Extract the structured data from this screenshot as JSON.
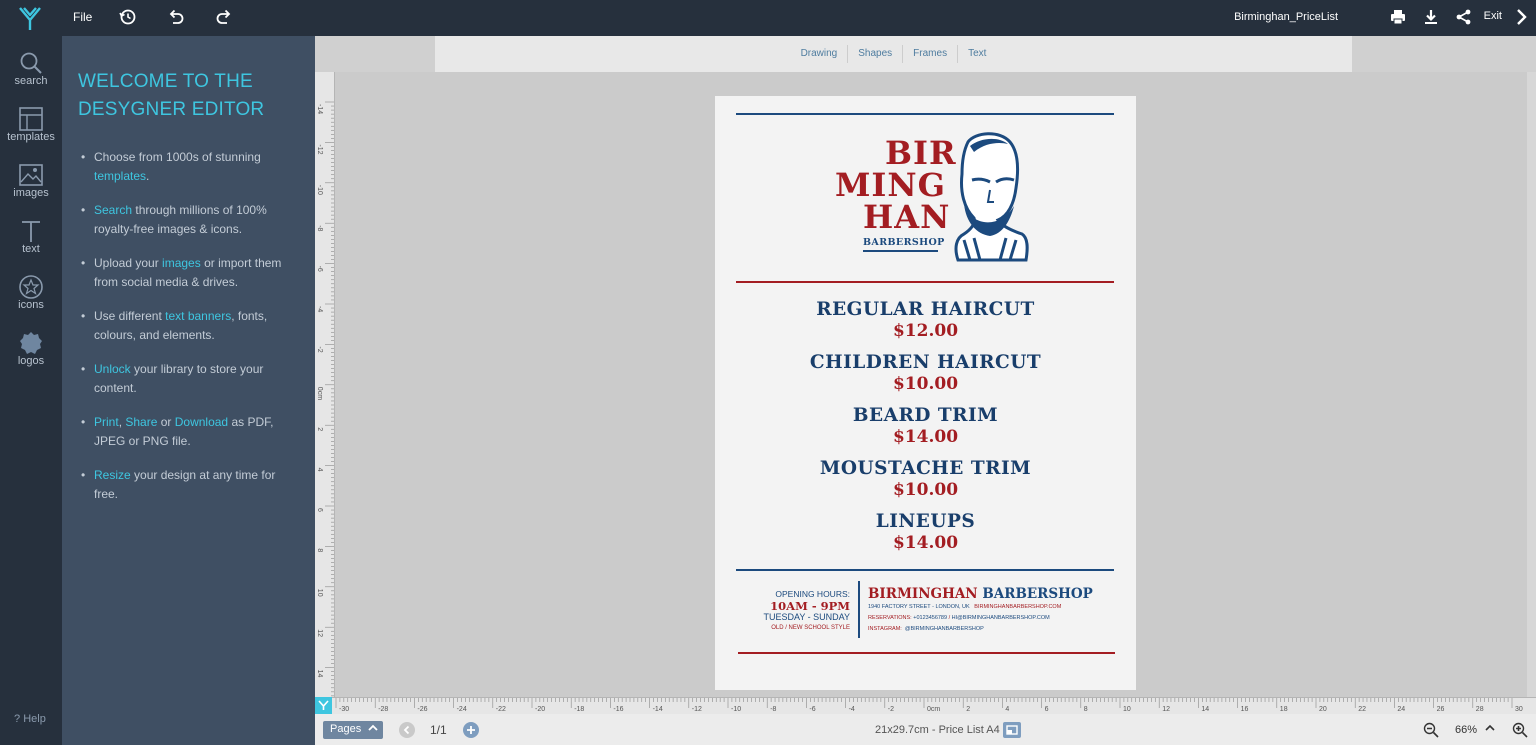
{
  "app": {
    "file_menu": "File",
    "document_name": "Birminghan_PriceList",
    "exit_label": "Exit"
  },
  "sidebar": {
    "items": [
      {
        "label": "search",
        "icon": "search-icon"
      },
      {
        "label": "templates",
        "icon": "templates-icon"
      },
      {
        "label": "images",
        "icon": "image-icon"
      },
      {
        "label": "text",
        "icon": "text-icon"
      },
      {
        "label": "icons",
        "icon": "star-icon"
      },
      {
        "label": "logos",
        "icon": "logo-shape-icon"
      }
    ],
    "help_label": "Help"
  },
  "panel": {
    "title": "WELCOME TO THE DESYGNER EDITOR",
    "bullets": [
      {
        "parts": [
          [
            "t",
            "Choose from 1000s of stunning "
          ],
          [
            "h",
            "templates"
          ],
          [
            "t",
            "."
          ]
        ]
      },
      {
        "parts": [
          [
            "h",
            "Search"
          ],
          [
            "t",
            " through millions of 100% royalty-free images & icons."
          ]
        ]
      },
      {
        "parts": [
          [
            "t",
            "Upload your "
          ],
          [
            "h",
            "images"
          ],
          [
            "t",
            " or import them from social media & drives."
          ]
        ]
      },
      {
        "parts": [
          [
            "t",
            "Use different "
          ],
          [
            "h",
            "text banners"
          ],
          [
            "t",
            ", fonts, colours, and elements."
          ]
        ]
      },
      {
        "parts": [
          [
            "h",
            "Unlock"
          ],
          [
            "t",
            " your library to store your content."
          ]
        ]
      },
      {
        "parts": [
          [
            "h",
            "Print"
          ],
          [
            "t",
            ", "
          ],
          [
            "h",
            "Share"
          ],
          [
            "t",
            " or "
          ],
          [
            "h",
            "Download"
          ],
          [
            "t",
            " as PDF, JPEG or PNG file."
          ]
        ]
      },
      {
        "parts": [
          [
            "h",
            "Resize"
          ],
          [
            "t",
            " your design at any time for free."
          ]
        ]
      }
    ]
  },
  "subtoolbar": {
    "tabs": [
      "Drawing",
      "Shapes",
      "Frames",
      "Text"
    ]
  },
  "rulers": {
    "horizontal": [
      "-30",
      "-28",
      "-26",
      "-24",
      "-22",
      "-20",
      "-18",
      "-16",
      "-14",
      "-12",
      "-10",
      "-8",
      "-6",
      "-4",
      "-2",
      "0cm",
      "2",
      "4",
      "6",
      "8",
      "10",
      "12",
      "14",
      "16",
      "18",
      "20",
      "22",
      "24",
      "26",
      "28",
      "30"
    ],
    "vertical": [
      "-14",
      "-12",
      "-10",
      "-8",
      "-6",
      "-4",
      "-2",
      "0cm",
      "2",
      "4",
      "6",
      "8",
      "10",
      "12",
      "14"
    ]
  },
  "poster": {
    "logo_lines": [
      "BIR",
      "MING",
      "HAN"
    ],
    "logo_sub": "BARBERSHOP",
    "services": [
      {
        "name": "REGULAR HAIRCUT",
        "price": "$12.00"
      },
      {
        "name": "CHILDREN HAIRCUT",
        "price": "$10.00"
      },
      {
        "name": "BEARD TRIM",
        "price": "$14.00"
      },
      {
        "name": "MOUSTACHE TRIM",
        "price": "$10.00"
      },
      {
        "name": "LINEUPS",
        "price": "$14.00"
      }
    ],
    "footer": {
      "opening_label": "OPENING HOURS:",
      "hours": "10AM - 9PM",
      "days": "TUESDAY - SUNDAY",
      "style": "OLD / NEW SCHOOL STYLE",
      "brand_red": "BIRMINGHAN",
      "brand_blue": "BARBERSHOP",
      "address": "1940 FACTORY STREET - LONDON, UK",
      "website": "BIRMINGHANBARBERSHOP.COM",
      "reservations_label": "RESERVATIONS:",
      "phone": "+0123456789",
      "email": "HI@BIRMINGHANBARBERSHOP.COM",
      "instagram_label": "INSTAGRAM:",
      "instagram": "@BIRMINGHANBARBERSHOP"
    },
    "colors": {
      "red": "#a31d22",
      "blue": "#193e6b"
    }
  },
  "bottombar": {
    "pages_label": "Pages",
    "page_count": "1/1",
    "page_size": "21x29.7cm - Price List A4",
    "zoom": "66%"
  },
  "colors": {
    "accent": "#3ec6e0",
    "topbar": "#26303d",
    "panel": "#3f4f63"
  }
}
